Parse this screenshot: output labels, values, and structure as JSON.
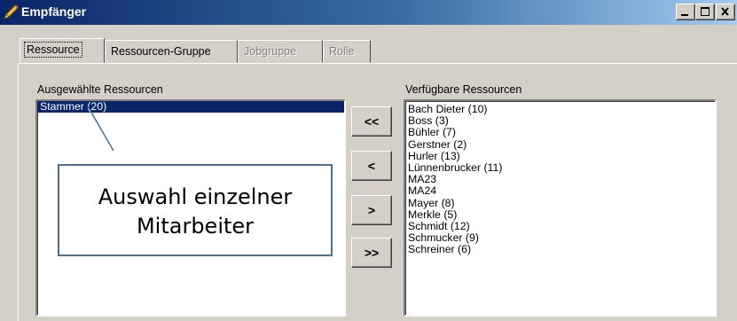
{
  "window": {
    "title": "Empfänger",
    "title_icon": "pencil-icon",
    "controls": [
      "minimize-icon",
      "maximize-icon",
      "close-icon"
    ]
  },
  "tabs": [
    {
      "label": "Ressource",
      "state": "active"
    },
    {
      "label": "Ressourcen-Gruppe",
      "state": "enabled"
    },
    {
      "label": "Jobgruppe",
      "state": "disabled"
    },
    {
      "label": "Rolle",
      "state": "disabled"
    }
  ],
  "selected_resources": {
    "label": "Ausgewählte Ressourcen",
    "items": [
      "Stammer (20)"
    ],
    "selected_index": 0
  },
  "available_resources": {
    "label": "Verfügbare Ressourcen",
    "items": [
      "Bach Dieter (10)",
      "Boss (3)",
      "Bühler (7)",
      "Gerstner (2)",
      "Hurler (13)",
      "Lünnenbrucker (11)",
      "MA23",
      "MA24",
      "Mayer (8)",
      "Merkle (5)",
      "Schmidt (12)",
      "Schmucker (9)",
      "Schreiner (6)"
    ]
  },
  "move_buttons": {
    "all_left": "<<",
    "one_left": "<",
    "one_right": ">",
    "all_right": ">>"
  },
  "annotation": {
    "line1": "Auswahl einzelner",
    "line2": "Mitarbeiter",
    "border_color": "#4a6fa5"
  },
  "colors": {
    "titlebar_start": "#0a246a",
    "titlebar_end": "#a6caf0",
    "selection": "#0a246a",
    "face": "#d4d0c8"
  }
}
